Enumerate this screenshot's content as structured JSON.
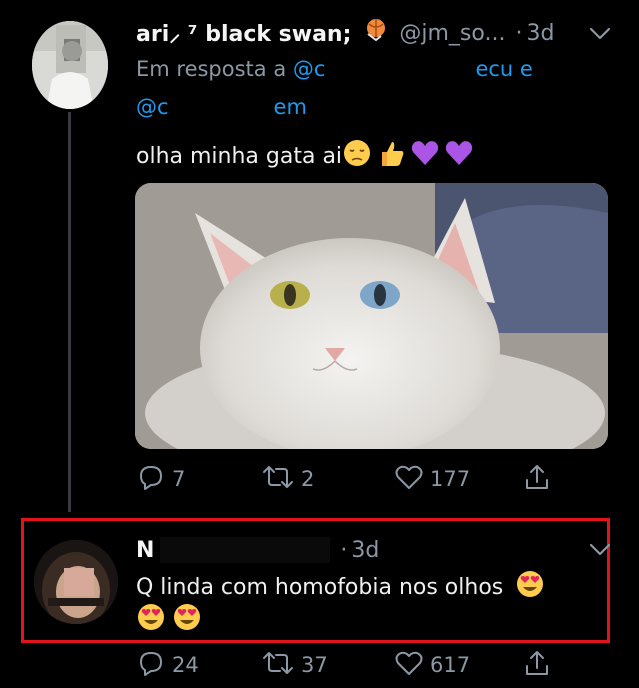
{
  "tweet1": {
    "name": "ari⸝ ⁷ black swan;",
    "handle": "@jm_so...",
    "dot": "·",
    "time": "3d",
    "reply_prefix": "Em resposta a",
    "mention1_start": "@c",
    "mention1_end": "ecu e",
    "mention2_start": "@c",
    "mention2_end": "em",
    "text": "olha minha gata ai",
    "emojis": [
      "pensive-face",
      "thumbs-up",
      "purple-heart",
      "purple-heart"
    ],
    "replies": "7",
    "retweets": "2",
    "likes": "177"
  },
  "tweet2": {
    "name": "N",
    "dot": "·",
    "time": "3d",
    "text_line1": "Q linda com homofobia nos olhos",
    "emojis": [
      "heart-eyes",
      "heart-eyes",
      "heart-eyes"
    ],
    "replies": "24",
    "retweets": "37",
    "likes": "617"
  },
  "colors": {
    "background": "#000000",
    "text": "#e7e9ea",
    "secondary": "#8b98a5",
    "link": "#1d9bf0",
    "highlight": "#e0141b"
  }
}
